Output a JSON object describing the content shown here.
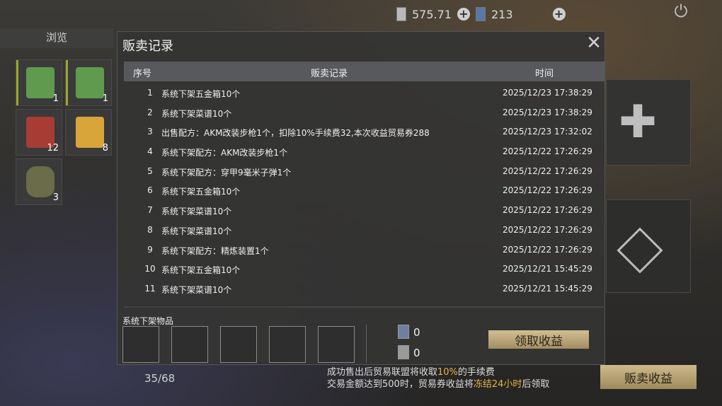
{
  "topbar": {
    "currency_a": "575.71",
    "currency_b": "213"
  },
  "left": {
    "browse_tab": "浏览",
    "capacity": "35/68",
    "items": [
      {
        "name": "green-pack",
        "count": "1"
      },
      {
        "name": "green-pack",
        "count": "1"
      },
      {
        "name": "canned-meat",
        "count": "12"
      },
      {
        "name": "fries",
        "count": "8"
      },
      {
        "name": "grenade",
        "count": "3"
      }
    ]
  },
  "right": {
    "sell_income_label": "贩卖收益"
  },
  "notice": {
    "line1_a": "成功售出后贸易联盟将收取",
    "line1_pct": "10%",
    "line1_b": "的手续费",
    "line2_a": "交易金额达到500时，贸易券收益将",
    "line2_gold": "冻结24小时",
    "line2_b": "后领取"
  },
  "modal": {
    "title": "贩卖记录",
    "columns": {
      "no": "序号",
      "record": "贩卖记录",
      "time": "时间"
    },
    "rows": [
      {
        "no": "1",
        "record": "系统下架五金箱10个",
        "time": "2025/12/23 17:38:29"
      },
      {
        "no": "2",
        "record": "系统下架菜谱10个",
        "time": "2025/12/23 17:38:29"
      },
      {
        "no": "3",
        "record": "出售配方：AKM改装步枪1个，扣除10%手续费32,本次收益贸易券288",
        "time": "2025/12/23 17:32:02"
      },
      {
        "no": "4",
        "record": "系统下架配方：AKM改装步枪1个",
        "time": "2025/12/22 17:26:29"
      },
      {
        "no": "5",
        "record": "系统下架配方：穿甲9毫米子弹1个",
        "time": "2025/12/22 17:26:29"
      },
      {
        "no": "6",
        "record": "系统下架五金箱10个",
        "time": "2025/12/22 17:26:29"
      },
      {
        "no": "7",
        "record": "系统下架菜谱10个",
        "time": "2025/12/22 17:26:29"
      },
      {
        "no": "8",
        "record": "系统下架菜谱10个",
        "time": "2025/12/22 17:26:29"
      },
      {
        "no": "9",
        "record": "系统下架配方：精炼装置1个",
        "time": "2025/12/22 17:26:29"
      },
      {
        "no": "10",
        "record": "系统下架五金箱10个",
        "time": "2025/12/21 15:45:29"
      },
      {
        "no": "11",
        "record": "系统下架菜谱10个",
        "time": "2025/12/21 15:45:29"
      }
    ],
    "unload_label": "系统下架物品",
    "coin_a_value": "0",
    "coin_b_value": "0",
    "claim_label": "领取收益"
  }
}
